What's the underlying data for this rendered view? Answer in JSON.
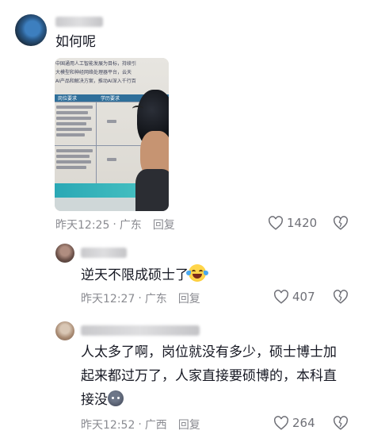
{
  "comments": [
    {
      "text": "如何呢",
      "time": "昨天12:25",
      "location": "广东",
      "reply_label": "回复",
      "likes": "1420",
      "has_image": true
    },
    {
      "text": "逆天不限成硕士了",
      "emoji": "laughing-crying-emoji",
      "time": "昨天12:27",
      "location": "广东",
      "reply_label": "回复",
      "likes": "407"
    },
    {
      "text_line1": "人太多了啊，岗位就没有多少，硕士博士加",
      "text_line2": "起来都过万了，人家直接要硕博的，本科直",
      "text_line3": "接没",
      "emoji": "blob-face-emoji",
      "time": "昨天12:52",
      "location": "广西",
      "reply_label": "回复",
      "likes": "264"
    }
  ],
  "photo_text": {
    "row1": "中国通用人工智能发展为目标，持续引",
    "row2": "大模型和神经网络处理器平台，云天",
    "row3": "AI产品和解决方案，推动AI深入千行百",
    "col1": "岗位要求",
    "col2": "学历要求"
  },
  "colors": {
    "text": "#161823",
    "meta": "#8a8b91",
    "background": "#ffffff"
  }
}
